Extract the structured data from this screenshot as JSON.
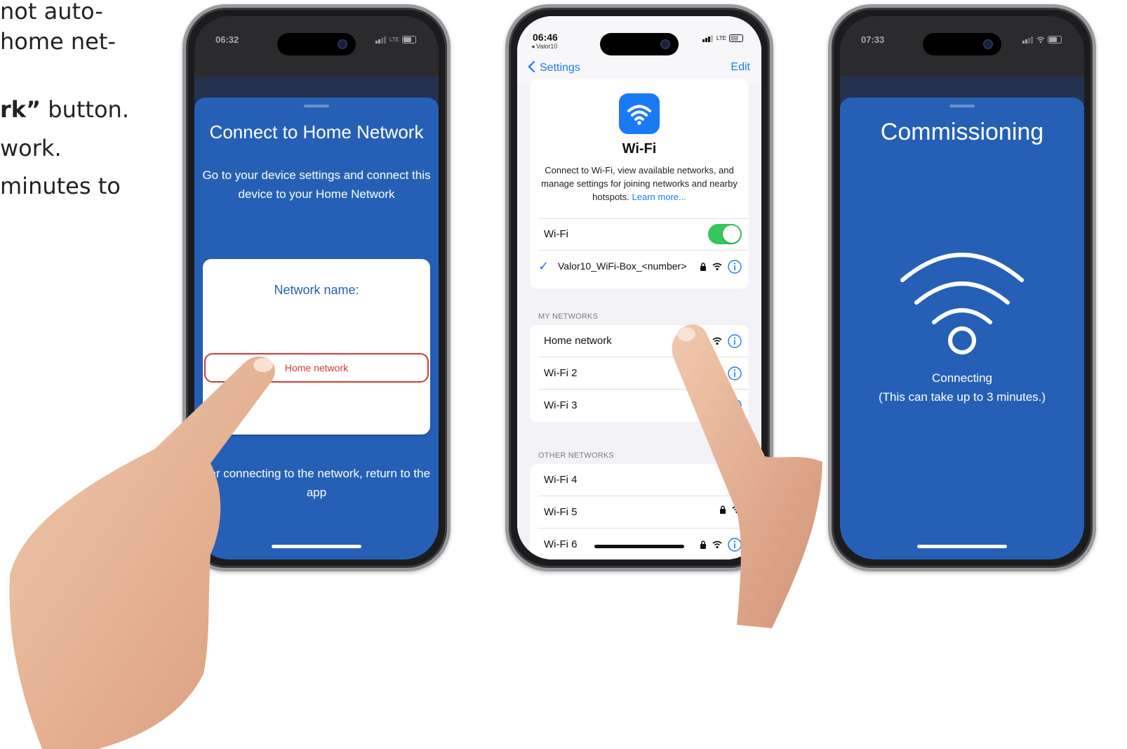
{
  "instructions": {
    "line1": "not auto-",
    "line2": "home net-",
    "line3_bold": "rk”",
    "line3_rest": " button.",
    "line4": "work.",
    "line5": "minutes to"
  },
  "phone1": {
    "status_time": "06:32",
    "status_network": "LTE",
    "title": "Connect to Home Network",
    "instruction": "Go to your device settings and connect this device to your Home Network",
    "network_label": "Network name:",
    "network_value": "Home network",
    "after_text": "fter connecting to the network, return to the app"
  },
  "phone2": {
    "status_time": "06:46",
    "status_network": "LTE",
    "back_app": "◂ Valor10",
    "nav_back": "Settings",
    "nav_edit": "Edit",
    "heading": "Wi-Fi",
    "description": "Connect to Wi-Fi, view available networks, and manage settings for joining networks and nearby hotspots.",
    "learn_more": "Learn more...",
    "wifi_toggle_label": "Wi-Fi",
    "wifi_enabled": true,
    "connected_network": "Valor10_WiFi-Box_<number>",
    "my_networks_label": "MY NETWORKS",
    "my_networks": [
      "Home network",
      "Wi-Fi 2",
      "Wi-Fi 3"
    ],
    "other_networks_label": "OTHER NETWORKS",
    "other_networks": [
      "Wi-Fi 4",
      "Wi-Fi 5",
      "Wi-Fi 6"
    ]
  },
  "phone3": {
    "status_time": "07:33",
    "title": "Commissioning",
    "status_line1": "Connecting",
    "status_line2": "(This can take up to 3 minutes.)"
  },
  "colors": {
    "app_blue": "#2660b6",
    "ios_blue": "#1a7af5",
    "toggle_green": "#35c759",
    "field_red": "#d23a35"
  }
}
